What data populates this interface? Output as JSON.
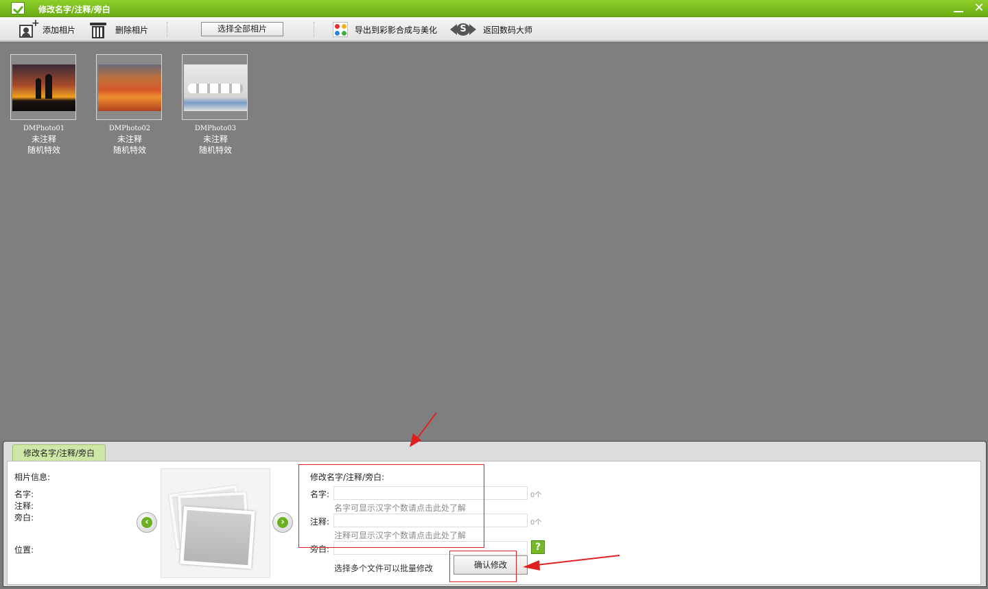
{
  "window": {
    "title": "修改名字/注释/旁白",
    "minimize": "—",
    "close": "✕"
  },
  "toolbar": {
    "add_photo": "添加相片",
    "delete_photo": "删除相片",
    "select_all": "选择全部相片",
    "export": "导出到彩影合成与美化",
    "back": "返回数码大师"
  },
  "photos": [
    {
      "name": "DMPhoto01",
      "note": "未注释",
      "effect": "随机特效"
    },
    {
      "name": "DMPhoto02",
      "note": "未注释",
      "effect": "随机特效"
    },
    {
      "name": "DMPhoto03",
      "note": "未注释",
      "effect": "随机特效"
    }
  ],
  "panel": {
    "tab_label": "修改名字/注释/旁白",
    "info": {
      "title": "相片信息:",
      "name_label": "名字:",
      "note_label": "注释:",
      "narration_label": "旁白:",
      "position_label": "位置:"
    },
    "nav": {
      "prev": "‹",
      "next": "›"
    },
    "form": {
      "title": "修改名字/注释/旁白:",
      "name_label": "名字:",
      "name_value": "",
      "name_count": "0个",
      "name_hint": "名字可显示汉字个数请点击此处了解",
      "note_label": "注释:",
      "note_value": "",
      "note_count": "0个",
      "note_hint": "注释可显示汉字个数请点击此处了解",
      "narration_label": "旁白:",
      "narration_value": "",
      "help": "?",
      "batch_note": "选择多个文件可以批量修改",
      "confirm": "确认修改"
    }
  }
}
